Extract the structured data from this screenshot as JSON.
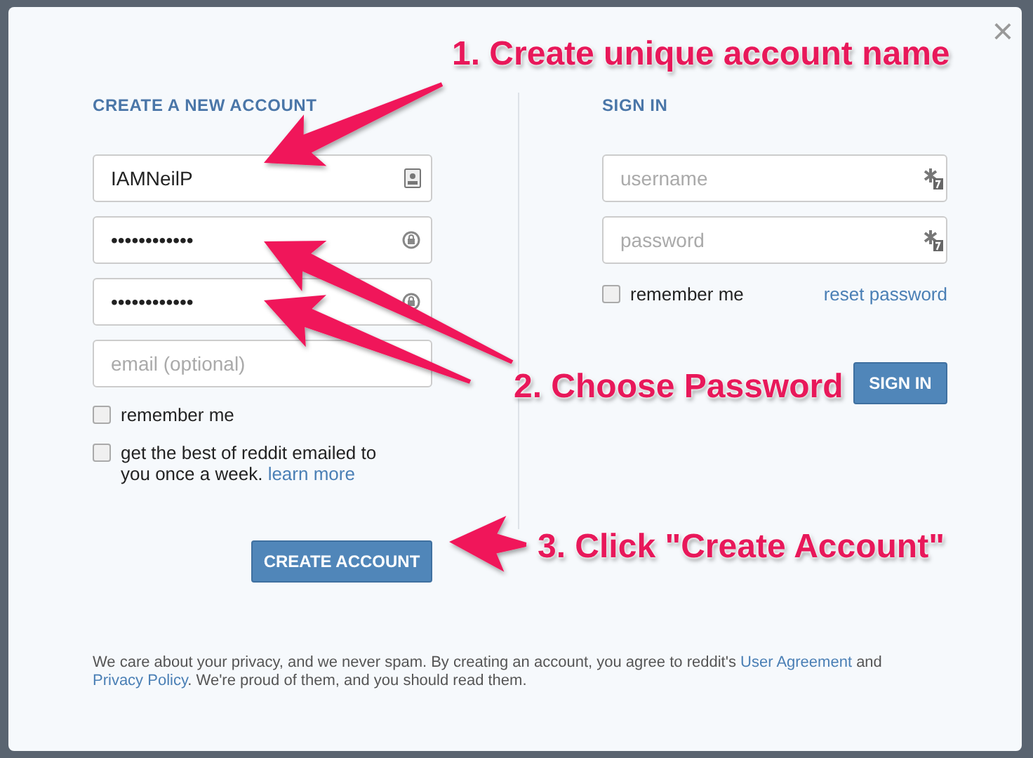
{
  "create_account": {
    "heading": "CREATE A NEW ACCOUNT",
    "fields": [
      {
        "kind": "username",
        "value": "IAMNeilP"
      },
      {
        "kind": "password",
        "value": "••••••••••••"
      },
      {
        "kind": "password",
        "value": "••••••••••••"
      },
      {
        "kind": "email",
        "placeholder": "email (optional)"
      }
    ],
    "checkboxes": [
      {
        "label": "remember me",
        "checked": false
      },
      {
        "label": "get the best of reddit emailed to you once a week.",
        "link": "learn more",
        "checked": false
      }
    ],
    "button": "CREATE ACCOUNT"
  },
  "sign_in": {
    "heading": "SIGN IN",
    "fields": [
      {
        "placeholder": "username"
      },
      {
        "placeholder": "password"
      }
    ],
    "remember": {
      "label": "remember me",
      "checked": false
    },
    "reset_link": "reset password",
    "button": "SIGN IN"
  },
  "footer": {
    "text_1": "We care about your privacy, and we never spam. By creating an account, you agree to reddit's",
    "link_1": "User Agreement",
    "text_2": "and",
    "link_2": "Privacy Policy",
    "text_3": ". We're proud of them, and you should read them."
  },
  "close": "×",
  "annotations": [
    "1. Create unique account name",
    "2. Choose Password",
    "3. Click \"Create Account\""
  ]
}
